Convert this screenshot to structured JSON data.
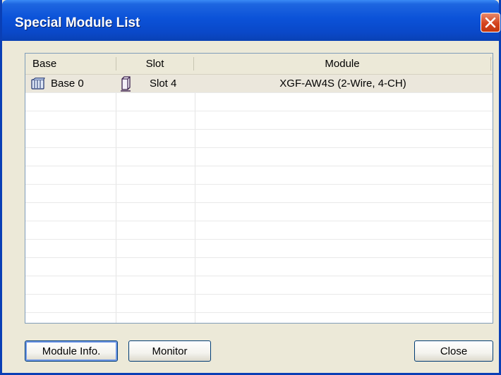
{
  "window": {
    "title": "Special Module List"
  },
  "list": {
    "columns": [
      "Base",
      "Slot",
      "Module"
    ],
    "rows": [
      {
        "base": "Base 0",
        "slot": "Slot 4",
        "module": "XGF-AW4S (2-Wire, 4-CH)",
        "base_icon": "base-rack-icon",
        "slot_icon": "module-slot-icon"
      }
    ]
  },
  "buttons": {
    "module_info": "Module Info.",
    "monitor": "Monitor",
    "close": "Close"
  },
  "colors": {
    "titlebar": "#0b52d8",
    "selected_row": "#ebe7dc",
    "close_button": "#d4431d"
  }
}
